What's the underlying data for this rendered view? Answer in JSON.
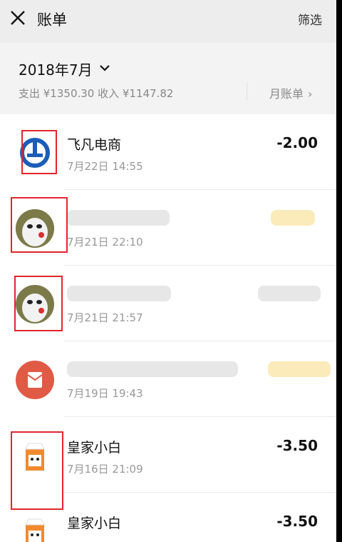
{
  "header": {
    "title": "账单",
    "filter_label": "筛选"
  },
  "month": {
    "selected": "2018年7月",
    "summary": "支出 ¥1350.30 收入 ¥1147.82",
    "bill_link": "月账单"
  },
  "transactions": [
    {
      "name": "飞凡电商",
      "time": "7月22日 14:55",
      "amount": "-2.00",
      "avatar": "feifan-logo"
    },
    {
      "name": "",
      "time": "7月21日 22:10",
      "amount": "",
      "avatar": "cat-avatar"
    },
    {
      "name": "",
      "time": "7月21日 21:57",
      "amount": "",
      "avatar": "cat-avatar"
    },
    {
      "name": "",
      "time": "7月19日 19:43",
      "amount": "",
      "avatar": "red-packet-icon"
    },
    {
      "name": "皇家小白",
      "time": "7月16日 21:09",
      "amount": "-3.50",
      "avatar": "milk-carton-icon"
    },
    {
      "name": "皇家小白",
      "time": "",
      "amount": "-3.50",
      "avatar": "milk-carton-icon"
    }
  ],
  "colors": {
    "background": "#ededed",
    "highlight_box": "#e0262c",
    "red_packet": "#e05a45",
    "feifan_blue": "#1b5eb8"
  }
}
